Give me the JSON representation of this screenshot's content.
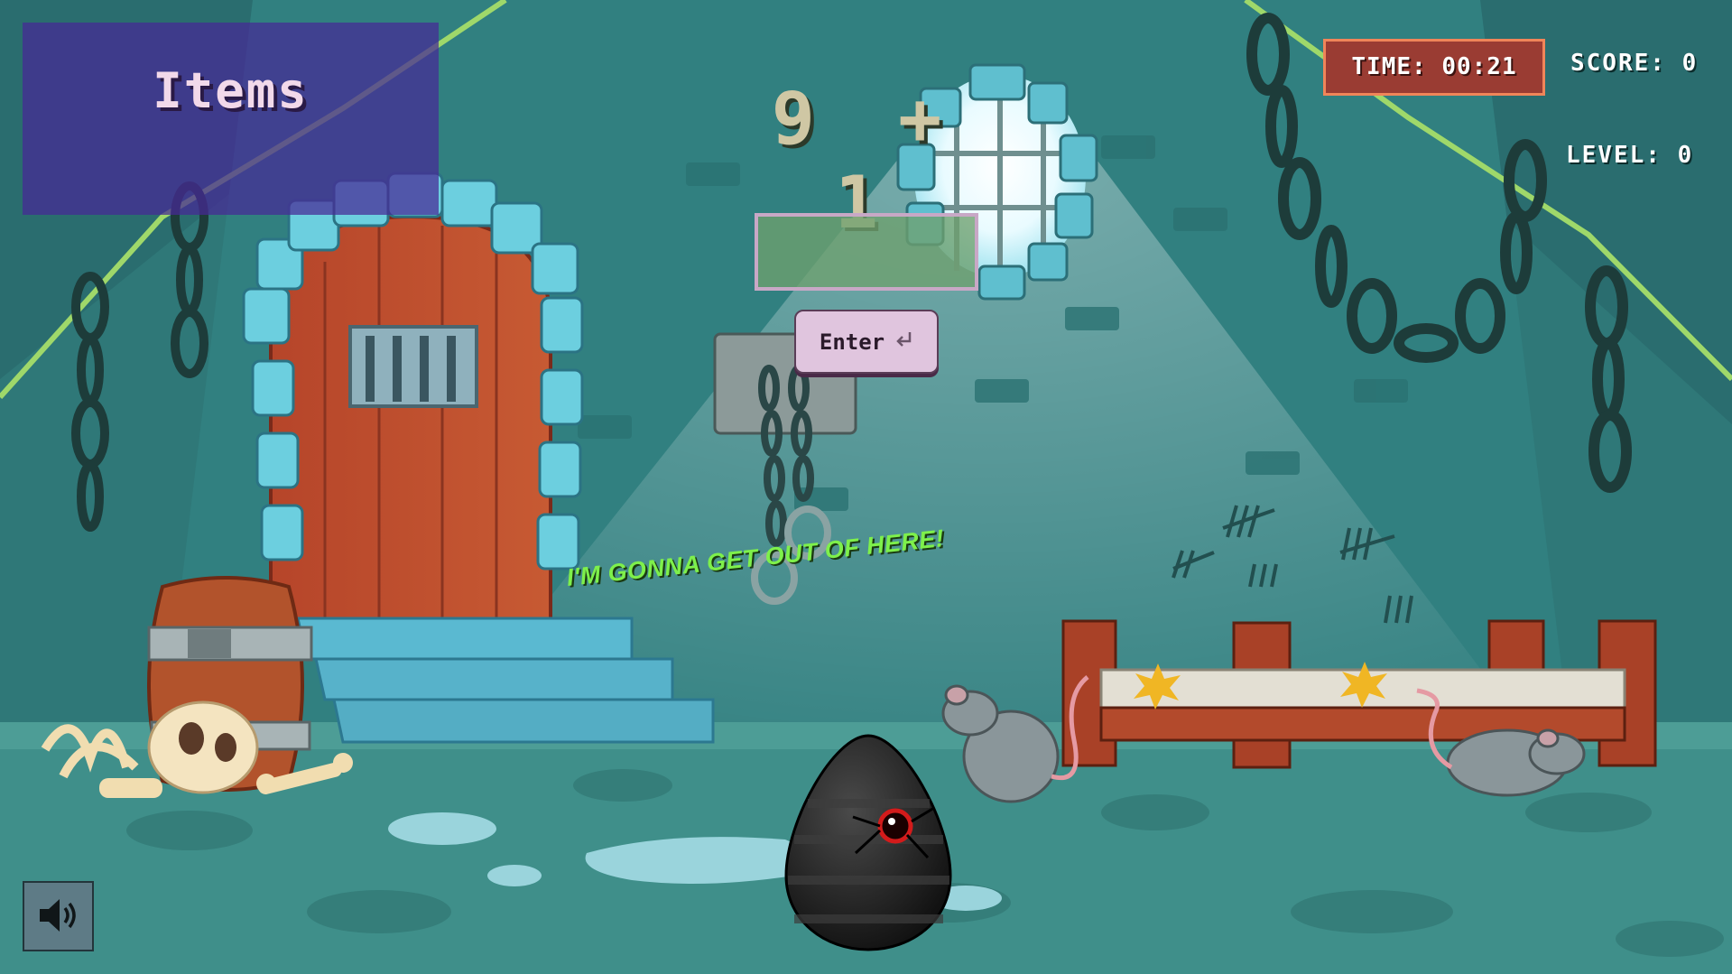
{
  "items_panel": {
    "title": "Items"
  },
  "hud": {
    "timer": "TIME: 00:21",
    "score": "SCORE: 0",
    "level": "LEVEL: 0"
  },
  "question": "9 + 1",
  "answer": {
    "value": "",
    "placeholder": ""
  },
  "enter_button": {
    "label": "Enter",
    "icon": "return-arrow-icon"
  },
  "speech_text": "I'M GONNA GET OUT OF HERE!",
  "sound_button": {
    "icon": "speaker-icon"
  },
  "colors": {
    "wall": "#2f7a7a",
    "floor": "#3f8f8a",
    "items_panel": "#46289a",
    "timer_bg": "#9a3c33",
    "timer_border": "#f08559",
    "speech": "#7ef04b",
    "enter_bg": "#e0c5de"
  }
}
